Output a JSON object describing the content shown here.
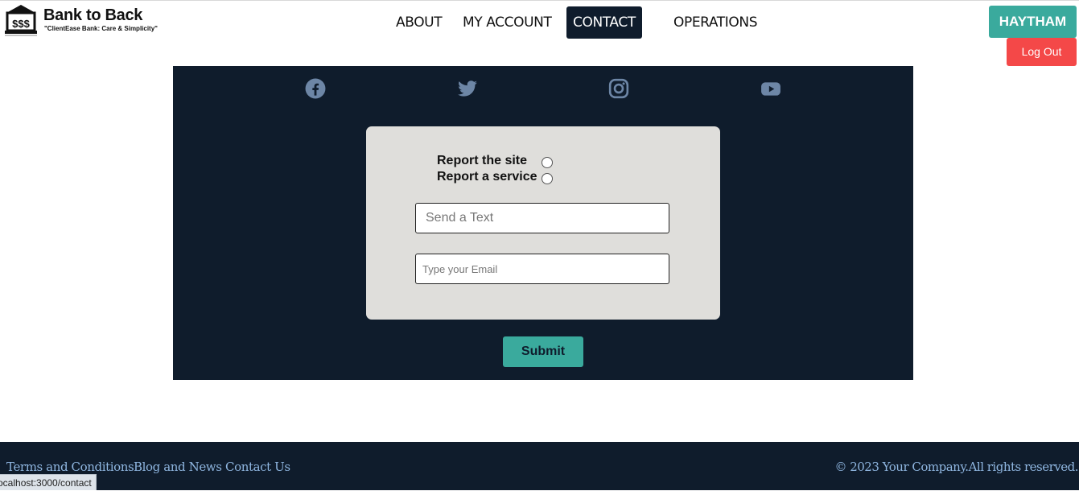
{
  "header": {
    "brand_title": "Bank to Back",
    "brand_tagline": "\"ClientEase Bank:  Care & Simplicity\"",
    "logo_icon": "bank-building-icon",
    "nav": [
      {
        "label": "ABOUT",
        "active": false
      },
      {
        "label": "MY ACCOUNT",
        "active": false
      },
      {
        "label": "CONTACT",
        "active": true
      },
      {
        "label": "OPERATIONS",
        "active": false
      }
    ],
    "user_label": "HAYTHAM",
    "logout_label": "Log Out"
  },
  "social": {
    "icons": [
      "facebook-icon",
      "twitter-icon",
      "instagram-icon",
      "youtube-icon"
    ],
    "color": "#6d86a6"
  },
  "contact_form": {
    "options": [
      {
        "label": "Report the site",
        "checked": false
      },
      {
        "label": "Report a service",
        "checked": false
      }
    ],
    "message_placeholder": "Send a Text",
    "email_placeholder": "Type your Email",
    "submit_label": "Submit"
  },
  "footer": {
    "links": [
      "Terms and Conditions",
      "Blog and News",
      "Contact Us"
    ],
    "copyright": "© 2023 Your Company.All rights reserved."
  },
  "status_bar": {
    "url": "ocalhost:3000/contact"
  },
  "colors": {
    "dark_navy": "#0f1c2c",
    "teal": "#3aaa9d",
    "logout_red": "#f44848",
    "card_gray": "#dfdedb",
    "footer_link": "#8fb6e0"
  }
}
